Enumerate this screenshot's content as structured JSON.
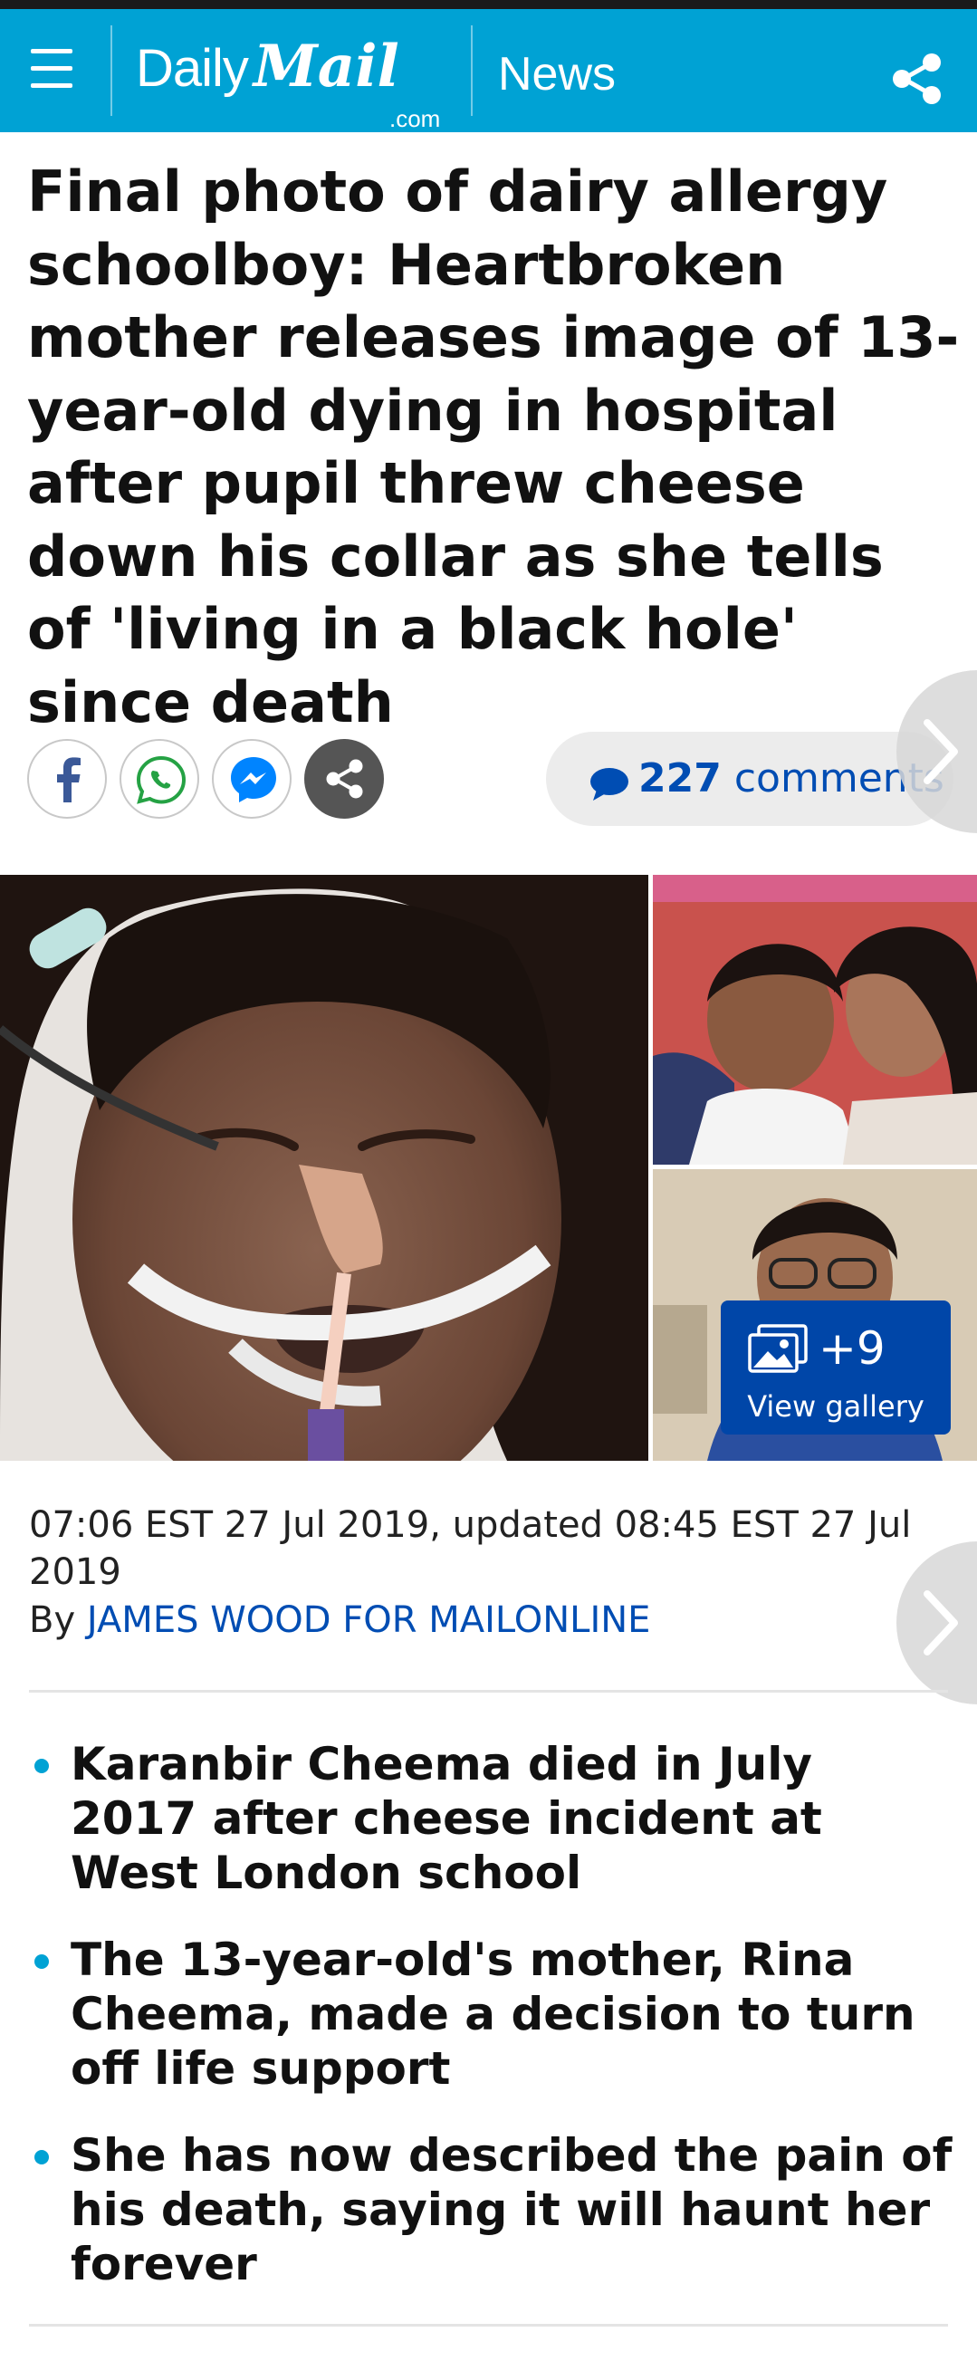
{
  "header": {
    "logo_daily": "Daily",
    "logo_mail": "Mail",
    "logo_com": ".com",
    "section": "News",
    "brand_color": "#00a2d4"
  },
  "article": {
    "headline": "Final photo of dairy allergy schoolboy: Heartbroken mother releases image of 13-year-old dying in hospital after pupil threw cheese down his collar as she tells of 'living in a black hole' since death",
    "comments_count": "227",
    "comments_label": "comments",
    "gallery_count": "+9",
    "gallery_label": "View gallery",
    "dateline": "07:06 EST 27 Jul 2019, updated 08:45 EST 27 Jul 2019",
    "by_prefix": "By",
    "author": "JAMES WOOD FOR MAILONLINE",
    "bullets": [
      "Karanbir Cheema died in July 2017 after cheese incident at West London school",
      "The 13-year-old's mother, Rina Cheema, made a decision to turn off life support",
      "She has now described the pain of his death, saying it will haunt her forever"
    ]
  },
  "share_buttons": [
    "facebook-icon",
    "whatsapp-icon",
    "messenger-icon",
    "share-icon"
  ],
  "colors": {
    "link": "#004db3",
    "gallery_button": "#0046a8"
  }
}
